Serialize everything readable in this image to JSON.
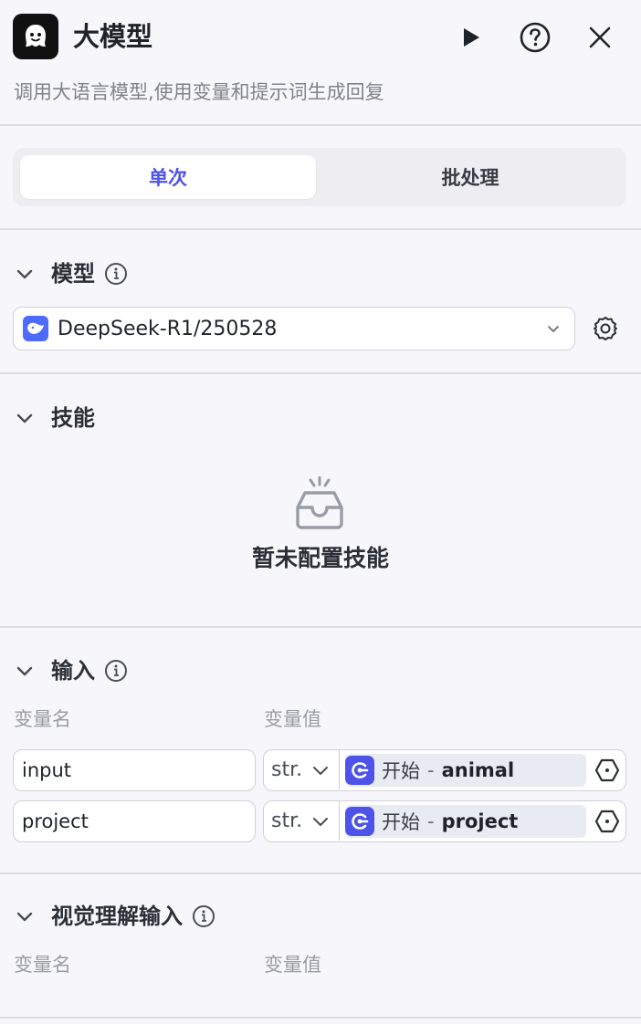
{
  "header": {
    "title": "大模型",
    "subtitle": "调用大语言模型,使用变量和提示词生成回复",
    "icons": {
      "logo": "ghost-logo-icon",
      "run": "play-icon",
      "help": "help-circle-icon",
      "close": "close-icon"
    }
  },
  "mode_tabs": {
    "single": "单次",
    "batch": "批处理",
    "active": "single"
  },
  "model_section": {
    "title": "模型",
    "selected_model": "DeepSeek-R1/250528"
  },
  "skills_section": {
    "title": "技能",
    "empty_text": "暂未配置技能"
  },
  "input_section": {
    "title": "输入",
    "col_name": "变量名",
    "col_value": "变量值",
    "rows": [
      {
        "name": "input",
        "type": "str.",
        "ref_node": "开始",
        "ref_sep": "-",
        "ref_var": "animal"
      },
      {
        "name": "project",
        "type": "str.",
        "ref_node": "开始",
        "ref_sep": "-",
        "ref_var": "project"
      }
    ]
  },
  "vision_section": {
    "title": "视觉理解输入",
    "col_name": "变量名",
    "col_value": "变量值"
  },
  "colors": {
    "accent": "#4d53e8",
    "deepseek": "#4d6bfe",
    "background": "#f7f7fb",
    "divider": "#dcdde3"
  }
}
